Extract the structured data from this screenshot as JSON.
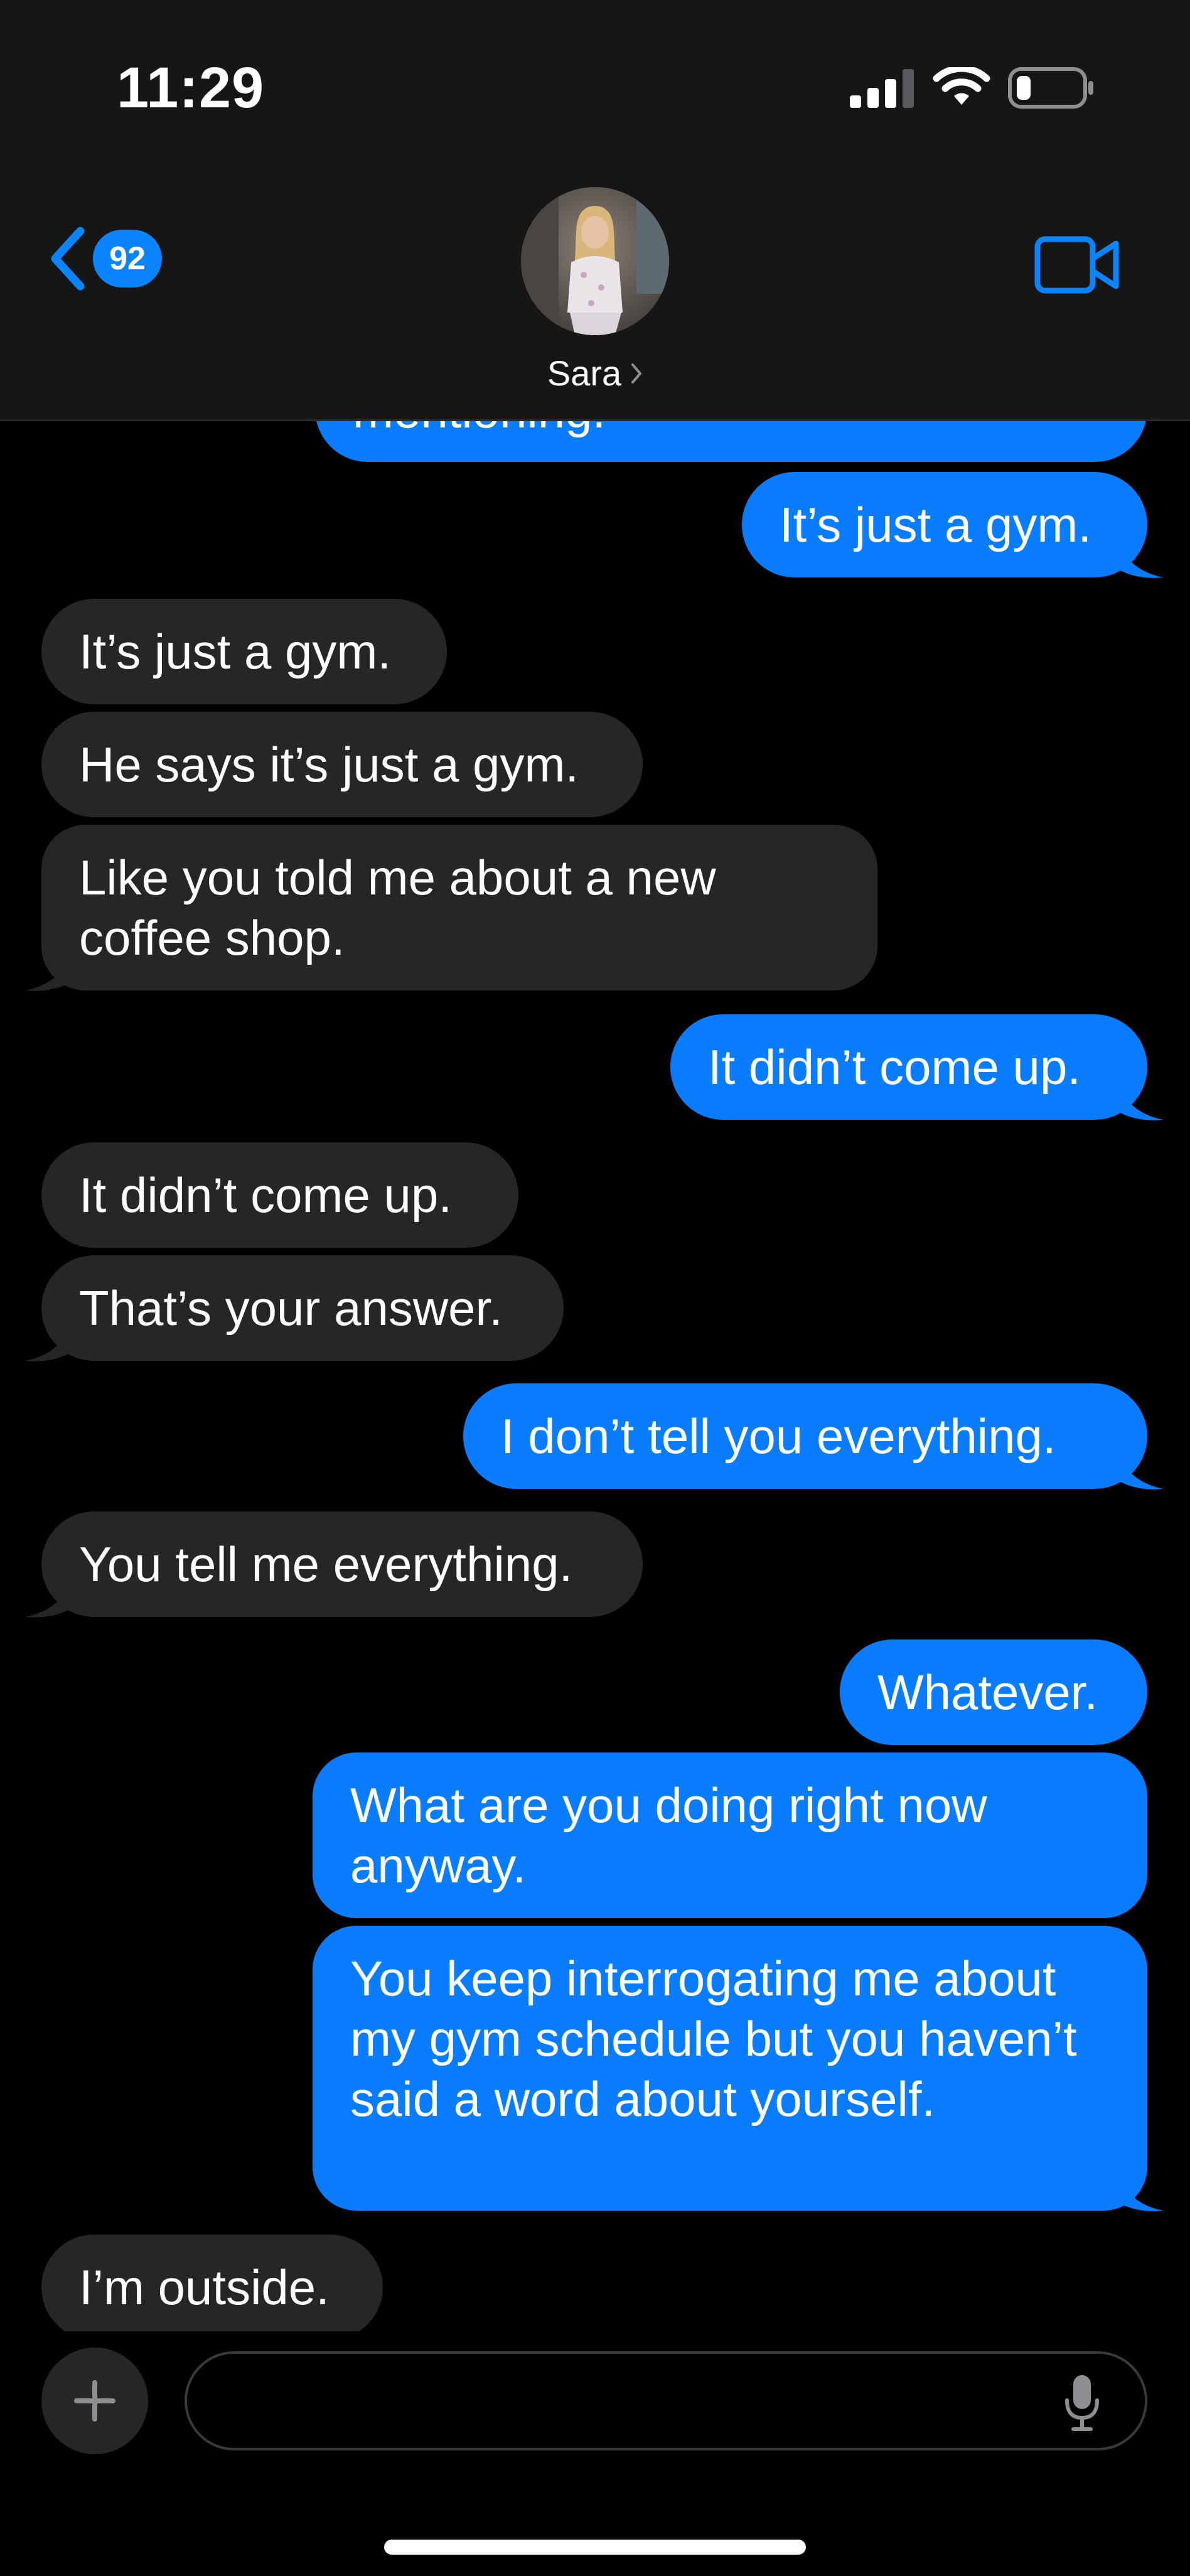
{
  "status_bar": {
    "time": "11:29",
    "signal_icon": "cellular-signal-icon",
    "wifi_icon": "wifi-icon",
    "battery_icon": "battery-low-icon"
  },
  "header": {
    "back_icon": "chevron-left-icon",
    "unread_count": "92",
    "contact_name": "Sara",
    "video_icon": "video-camera-icon",
    "accent_color": "#0a84ff"
  },
  "messages": [
    {
      "side": "out",
      "text": "mentioning."
    },
    {
      "side": "out",
      "text": "It’s just a gym."
    },
    {
      "side": "in",
      "text": "It’s just a gym."
    },
    {
      "side": "in",
      "text": "He says it’s just a gym."
    },
    {
      "side": "in",
      "text": "Like you told me about a new coffee shop."
    },
    {
      "side": "out",
      "text": "It didn’t come up."
    },
    {
      "side": "in",
      "text": "It didn’t come up."
    },
    {
      "side": "in",
      "text": "That’s your answer."
    },
    {
      "side": "out",
      "text": "I don’t tell you everything."
    },
    {
      "side": "in",
      "text": "You tell me everything."
    },
    {
      "side": "out",
      "text": "Whatever."
    },
    {
      "side": "out",
      "text": "What are you doing right now anyway."
    },
    {
      "side": "out",
      "text": "You keep interrogating me about my gym schedule but you haven’t said a word about yourself."
    },
    {
      "side": "in",
      "text": "I’m outside."
    }
  ],
  "composer": {
    "placeholder": "",
    "plus_icon": "plus-icon",
    "mic_icon": "microphone-icon"
  },
  "colors": {
    "outgoing_bubble": "#0a7cff",
    "incoming_bubble": "#262628",
    "background": "#000000"
  }
}
